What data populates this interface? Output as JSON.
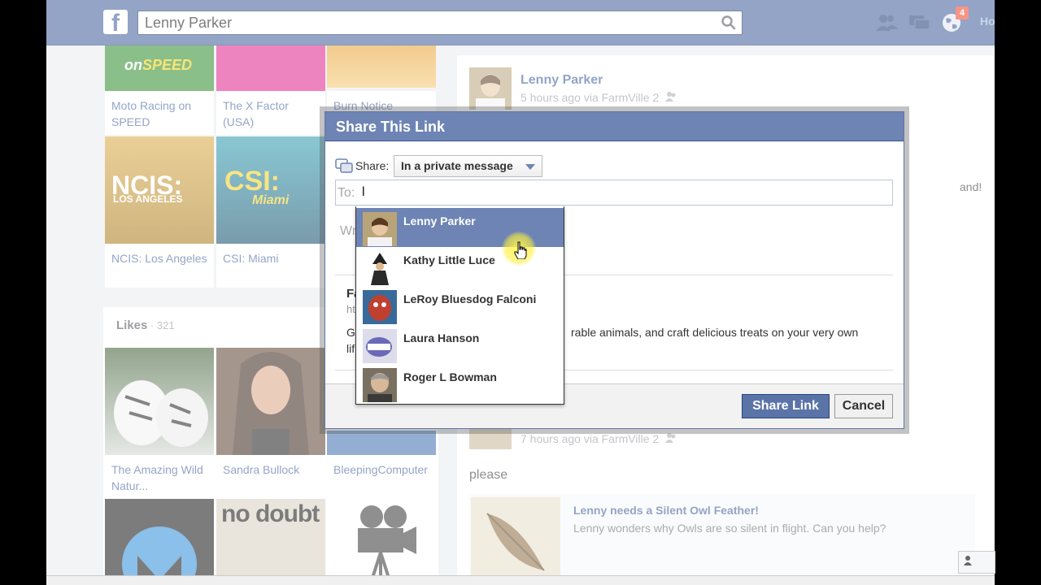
{
  "topbar": {
    "search_value": "Lenny Parker",
    "notification_count": "4",
    "home_link": "Ho"
  },
  "left_column": {
    "tiles_top": [
      {
        "label": "Moto Racing on SPEED"
      },
      {
        "label": "The X Factor (USA)"
      },
      {
        "label": "Burn Notice"
      }
    ],
    "tiles_mid": [
      {
        "label": "NCIS: Los Angeles"
      },
      {
        "label": "CSI: Miami"
      }
    ],
    "likes": {
      "title": "Likes",
      "separator": " · ",
      "count": "321",
      "tiles": [
        {
          "label": "The Amazing Wild Natur..."
        },
        {
          "label": "Sandra Bullock"
        },
        {
          "label": "BleepingComputer"
        }
      ]
    }
  },
  "right_column": {
    "post1": {
      "name": "Lenny Parker",
      "meta": "5 hours ago via FarmVille 2"
    },
    "post1_snippet": "and!",
    "post2": {
      "meta": "7 hours ago via FarmVille 2",
      "text": "please"
    },
    "story": {
      "title": "Lenny needs a Silent Owl Feather!",
      "desc": "Lenny wonders why Owls are so silent in flight. Can you help?"
    }
  },
  "dialog": {
    "title": "Share This Link",
    "share_label": "Share:",
    "share_option": "In a private message",
    "to_label": "To:",
    "to_value": "l",
    "message_placeholder": "Wr",
    "preview": {
      "title": "Fa",
      "url": "ht",
      "desc_left": "Gr",
      "desc_right": "rable animals, and craft delicious treats on your very own",
      "desc_line2": "lif"
    },
    "share_button": "Share Link",
    "cancel_button": "Cancel"
  },
  "typeahead": {
    "items": [
      {
        "name": "Lenny Parker",
        "selected": true
      },
      {
        "name": "Kathy Little Luce",
        "selected": false
      },
      {
        "name": "LeRoy Bluesdog Falconi",
        "selected": false
      },
      {
        "name": "Laura Hanson",
        "selected": false
      },
      {
        "name": "Roger L Bowman",
        "selected": false
      }
    ]
  },
  "colors": {
    "brand": "#3b5998",
    "dialog_header": "#6d84b4",
    "selected_row": "#6d84b4"
  }
}
